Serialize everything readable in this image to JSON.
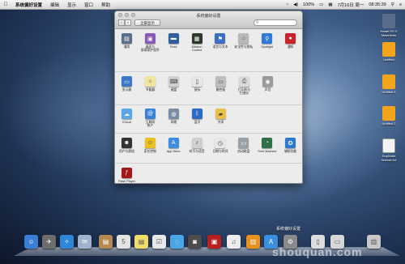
{
  "menubar": {
    "app": "系统偏好设置",
    "items": [
      "编辑",
      "显示",
      "窗口",
      "帮助"
    ],
    "battery": "100%",
    "date": "7月16日 周一",
    "time": "08:35:39"
  },
  "window": {
    "title": "系统偏好设置",
    "show_all": "全部显示",
    "search_placeholder": "",
    "rows": [
      [
        {
          "label": "通用",
          "icon": "general-icon",
          "color": "#5a6f8c"
        },
        {
          "label": "桌面与\n屏幕保护程序",
          "icon": "desktop-icon",
          "color": "#8a5ab8"
        },
        {
          "label": "Dock",
          "icon": "dock-icon",
          "color": "#2f5e9e"
        },
        {
          "label": "Mission\nControl",
          "icon": "mission-control-icon",
          "color": "#2d3a2a"
        },
        {
          "label": "语言与文本",
          "icon": "language-icon",
          "color": "#3b6dc2"
        },
        {
          "label": "安全性与隐私",
          "icon": "security-icon",
          "color": "#b8b8b8"
        },
        {
          "label": "Spotlight",
          "icon": "spotlight-icon",
          "color": "#2e7ad8"
        },
        {
          "label": "通知",
          "icon": "notifications-icon",
          "color": "#c8222a"
        }
      ],
      [
        {
          "label": "显示器",
          "icon": "displays-icon",
          "color": "#3b78c9"
        },
        {
          "label": "节能器",
          "icon": "energy-saver-icon",
          "color": "#f0e6a0"
        },
        {
          "label": "键盘",
          "icon": "keyboard-icon",
          "color": "#cfcfcf"
        },
        {
          "label": "鼠标",
          "icon": "mouse-icon",
          "color": "#e6e6e6"
        },
        {
          "label": "触控板",
          "icon": "trackpad-icon",
          "color": "#bdbdbd"
        },
        {
          "label": "打印机与\n扫描仪",
          "icon": "printer-icon",
          "color": "#dadada"
        },
        {
          "label": "声音",
          "icon": "sound-icon",
          "color": "#9a9a9a"
        }
      ],
      [
        {
          "label": "iCloud",
          "icon": "icloud-icon",
          "color": "#5aa6e8"
        },
        {
          "label": "互联网\n帐户",
          "icon": "internet-accounts-icon",
          "color": "#3a82d6"
        },
        {
          "label": "网络",
          "icon": "network-icon",
          "color": "#7a8ea8"
        },
        {
          "label": "蓝牙",
          "icon": "bluetooth-icon",
          "color": "#2d6ac6"
        },
        {
          "label": "共享",
          "icon": "sharing-icon",
          "color": "#e8c04a"
        }
      ],
      [
        {
          "label": "用户与群组",
          "icon": "users-icon",
          "color": "#333333"
        },
        {
          "label": "家长控制",
          "icon": "parental-controls-icon",
          "color": "#e8c020"
        },
        {
          "label": "App Store",
          "icon": "app-store-icon",
          "color": "#3a8ee0"
        },
        {
          "label": "听写与语音",
          "icon": "dictation-icon",
          "color": "#d0d0d0"
        },
        {
          "label": "日期与时间",
          "icon": "date-time-icon",
          "color": "#e6e6e6"
        },
        {
          "label": "启动磁盘",
          "icon": "startup-disk-icon",
          "color": "#9aa0a8"
        },
        {
          "label": "Time Machine",
          "icon": "time-machine-icon",
          "color": "#2f6f4a"
        },
        {
          "label": "辅助功能",
          "icon": "accessibility-icon",
          "color": "#2a7ad4"
        }
      ],
      [
        {
          "label": "Flash Player",
          "icon": "flash-player-icon",
          "color": "#a31818"
        }
      ]
    ]
  },
  "desktop": {
    "items": [
      {
        "label": "Install OS X\nMavericks",
        "icon": "installer-icon",
        "color": "#5a6e8c"
      },
      {
        "label": "Untitled",
        "icon": "folder-icon",
        "color": "#f2a51c"
      },
      {
        "label": "Untitled 3",
        "icon": "folder-icon",
        "color": "#f2a51c"
      },
      {
        "label": "Untitled 2",
        "icon": "folder-icon",
        "color": "#f2a51c"
      },
      {
        "label": "Duplicate\nlicense.txt",
        "icon": "text-file-icon",
        "color": "#f4f4f4"
      }
    ]
  },
  "dock": {
    "tooltip": "系统偏好设置",
    "watermark": "shouquan.com",
    "apps": [
      {
        "name": "finder-icon",
        "color": "#3a7ed6"
      },
      {
        "name": "launchpad-icon",
        "color": "#6c6c6c"
      },
      {
        "name": "safari-icon",
        "color": "#2e86d9"
      },
      {
        "name": "mail-icon",
        "color": "#9fb4cc"
      },
      {
        "name": "contacts-icon",
        "color": "#b58a52"
      },
      {
        "name": "calendar-icon",
        "color": "#e4e4e4"
      },
      {
        "name": "notes-icon",
        "color": "#f0de6a"
      },
      {
        "name": "reminders-icon",
        "color": "#e9e9e9"
      },
      {
        "name": "messages-icon",
        "color": "#4aa6e6"
      },
      {
        "name": "facetime-icon",
        "color": "#4c4c4c"
      },
      {
        "name": "photo-booth-icon",
        "color": "#b82020"
      },
      {
        "name": "itunes-icon",
        "color": "#ececec"
      },
      {
        "name": "ibooks-icon",
        "color": "#e8911c"
      },
      {
        "name": "app-store-dock-icon",
        "color": "#3c8ee0"
      },
      {
        "name": "system-preferences-dock-icon",
        "color": "#8a8a8a"
      },
      {
        "name": "documents-stack-icon",
        "color": "#dcdcdc"
      },
      {
        "name": "downloads-stack-icon",
        "color": "#d8d8d8"
      },
      {
        "name": "trash-icon",
        "color": "#c8c8c8"
      }
    ]
  }
}
